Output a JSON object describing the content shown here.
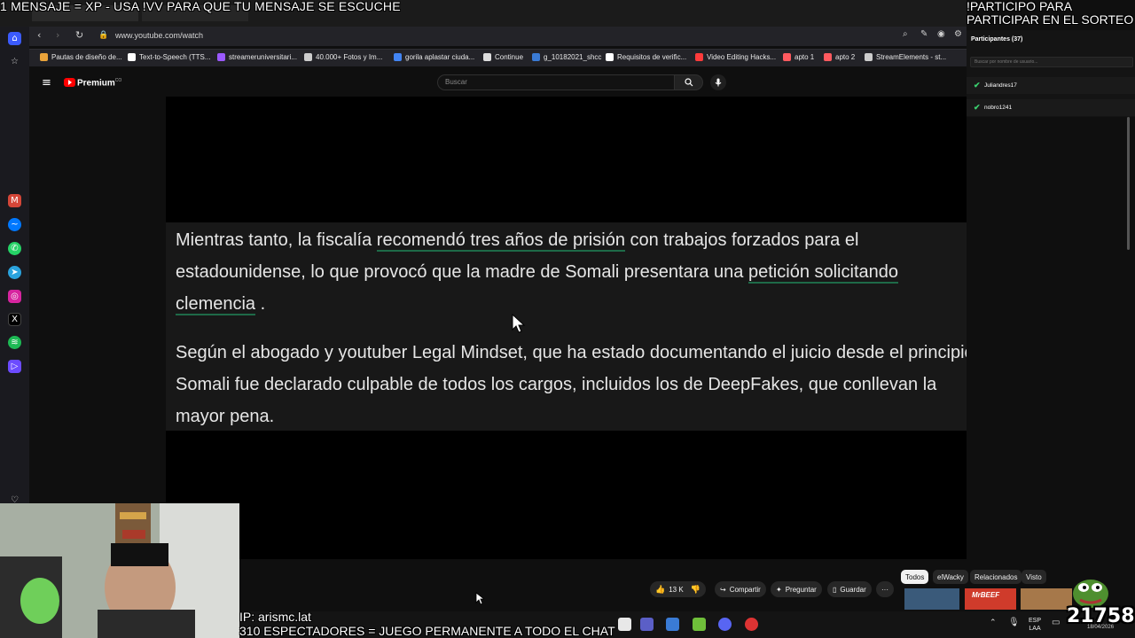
{
  "overlays": {
    "top_banner": "1 MENSAJE = XP - USA !VV PARA QUE TU MENSAJE SE ESCUCHE",
    "right_banner_line1": "!PARTICIPO PARA",
    "right_banner_line2": "PARTICIPAR EN EL SORTEO",
    "bottom_line1": "IP: arismc.lat",
    "bottom_line2": "310 ESPECTADORES = JUEGO PERMANENTE A TODO EL CHAT",
    "counter": "21758"
  },
  "browser": {
    "url": "www.youtube.com/watch",
    "bookmarks": [
      {
        "label": "Pautas de diseño de...",
        "color": "#e9a33a"
      },
      {
        "label": "Text-to-Speech (TTS...",
        "color": "#ffffff"
      },
      {
        "label": "streameruniversitari...",
        "color": "#9b59ff"
      },
      {
        "label": "40.000+ Fotos y Im...",
        "color": "#cccccc"
      },
      {
        "label": "gorila aplastar ciuda...",
        "color": "#4285f4"
      },
      {
        "label": "Continue",
        "color": "#dddddd"
      },
      {
        "label": "g_10182021_shcc",
        "color": "#3a7bd5"
      },
      {
        "label": "Requisitos de verific...",
        "color": "#ffffff"
      },
      {
        "label": "Video Editing Hacks...",
        "color": "#ff3b3b"
      },
      {
        "label": "apto 1",
        "color": "#ff5a5f"
      },
      {
        "label": "apto 2",
        "color": "#ff5a5f"
      },
      {
        "label": "StreamElements - st...",
        "color": "#cccccc"
      }
    ]
  },
  "youtube": {
    "brand": "Premium",
    "brand_sup": "CO",
    "search_placeholder": "Buscar",
    "caption": {
      "p1_a": "Mientras tanto, la fiscalía ",
      "p1_link1": "recomendó tres años de prisión",
      "p1_b": " con trabajos forzados para el estadounidense, lo que provocó que la madre de Somali presentara una ",
      "p1_link2": "petición solicitando clemencia",
      "p1_c": " .",
      "p2": "Según el abogado y youtuber Legal Mindset, que ha estado documentando el juicio desde el principio, Somali fue declarado culpable de todos los cargos, incluidos los de DeepFakes, que conllevan la mayor pena."
    },
    "actions": {
      "likes": "13 K",
      "share": "Compartir",
      "ask": "Preguntar",
      "save": "Guardar",
      "more": "···"
    },
    "chips": [
      "Todos",
      "elWacky",
      "Relacionados",
      "Visto"
    ],
    "thumb_label": "MrBEEF"
  },
  "participants_panel": {
    "title": "Participantes (37)",
    "search_placeholder": "Buscar por nombre de usuario...",
    "users": [
      "Juliandres17",
      "nobro1241"
    ]
  },
  "taskbar": {
    "lang_top": "ESP",
    "lang_bottom": "LAA",
    "date": "18/04/2026"
  }
}
